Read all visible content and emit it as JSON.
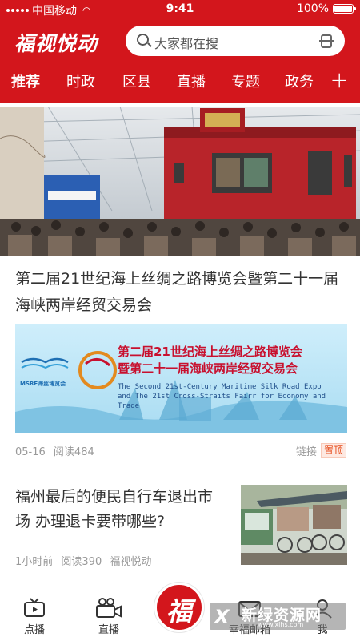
{
  "status_bar": {
    "carrier": "中国移动",
    "time": "9:41",
    "battery": "100%"
  },
  "header": {
    "app_name": "福视悦动",
    "search_placeholder": "大家都在搜",
    "tabs": [
      "推荐",
      "时政",
      "区县",
      "直播",
      "专题",
      "政务"
    ],
    "active_tab": "推荐"
  },
  "feed": {
    "article1": {
      "title": "第二届21世纪海上丝绸之路博览会暨第二十一届海峡两岸经贸交易会",
      "banner_title_cn_1": "第二届21世纪海上丝绸之路博览会",
      "banner_title_cn_2": "暨第二十一届海峡两岸经贸交易会",
      "banner_title_en_1": "The Second 21st-Century Maritime  Silk Road Expo",
      "banner_title_en_2": "and The 21st Cross-Straits Fairr for Economy and Trade",
      "banner_logo": "MSRE海丝博览会",
      "date": "05-16",
      "reads": "阅读484",
      "link_label": "链接",
      "pinned_badge": "置顶"
    },
    "article2": {
      "title": "福州最后的便民自行车退出市场 办理退卡要带哪些?",
      "time": "1小时前",
      "reads": "阅读390",
      "source": "福视悦动"
    }
  },
  "bottom_nav": {
    "items": [
      "点播",
      "直播",
      "幸福邮箱",
      "我"
    ],
    "center_glyph": "福"
  },
  "watermark": {
    "main": "新绿资源网",
    "sub": "www.xlhs.com"
  },
  "colors": {
    "brand_red": "#d3161c",
    "badge_orange": "#e64a19",
    "meta_gray": "#999999"
  }
}
